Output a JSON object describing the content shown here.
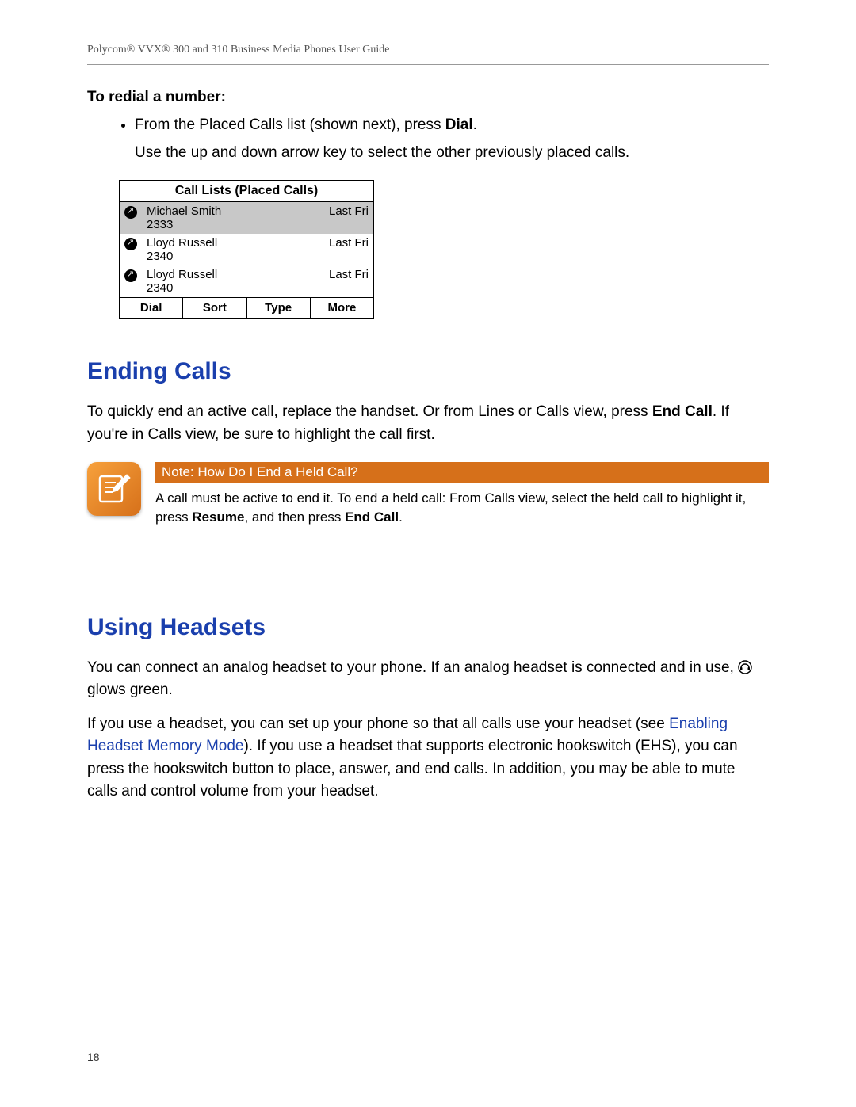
{
  "header": "Polycom® VVX® 300 and 310 Business Media Phones User Guide",
  "redial": {
    "subhead": "To redial a number:",
    "bullet_text_1": "From the Placed Calls list (shown next), press ",
    "bullet_bold": "Dial",
    "bullet_text_2": ".",
    "bullet_after": "Use the up and down arrow key to select the other previously placed calls."
  },
  "phone": {
    "title": "Call Lists (Placed Calls)",
    "rows": [
      {
        "name": "Michael Smith",
        "ext": "2333",
        "time": "Last Fri",
        "selected": true
      },
      {
        "name": "Lloyd Russell",
        "ext": "2340",
        "time": "Last Fri",
        "selected": false
      },
      {
        "name": "Lloyd Russell",
        "ext": "2340",
        "time": "Last Fri",
        "selected": false
      }
    ],
    "softkeys": [
      "Dial",
      "Sort",
      "Type",
      "More"
    ]
  },
  "ending": {
    "heading": "Ending Calls",
    "p1_a": "To quickly end an active call, replace the handset. Or from Lines or Calls view, press ",
    "p1_b": "End Call",
    "p1_c": ". If you're in Calls view, be sure to highlight the call first."
  },
  "note": {
    "title": "Note: How Do I End a Held Call?",
    "t1": "A call must be active to end it. To end a held call: From Calls view, select the held call to highlight it, press ",
    "b1": "Resume",
    "t2": ", and then press ",
    "b2": "End Call",
    "t3": "."
  },
  "headsets": {
    "heading": "Using Headsets",
    "p1_a": "You can connect an analog headset to your phone. If an analog headset is connected and in use, ",
    "p1_b": " glows green.",
    "p2_a": "If you use a headset, you can set up your phone so that all calls use your headset (see ",
    "p2_link": "Enabling Headset Memory Mode",
    "p2_b": "). If you use a headset that supports electronic hookswitch (EHS), you can press the hookswitch button to place, answer, and end calls. In addition, you may be able to mute calls and control volume from your headset."
  },
  "page_number": "18"
}
